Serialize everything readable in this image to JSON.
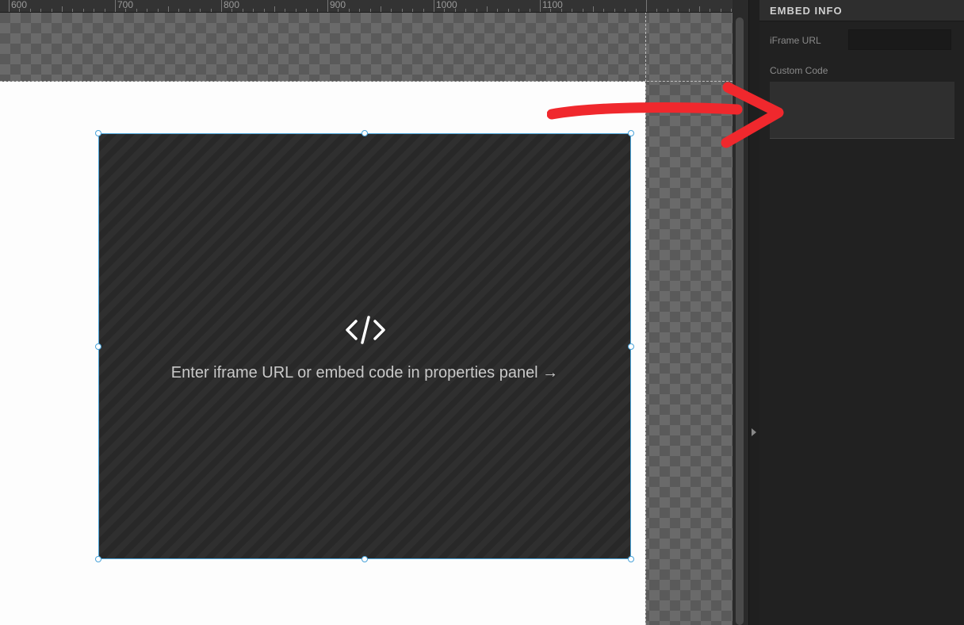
{
  "ruler": {
    "labels": [
      "600",
      "700",
      "800",
      "900",
      "1000",
      "1100"
    ]
  },
  "embed_placeholder": {
    "icon": "code-icon",
    "message": "Enter iframe URL or embed code in properties panel →"
  },
  "panel": {
    "title": "EMBED INFO",
    "iframe_url_label": "iFrame URL",
    "iframe_url_value": "",
    "custom_code_label": "Custom Code",
    "custom_code_value": ""
  },
  "colors": {
    "selection": "#4aa3d9",
    "annotation_arrow": "#f0282d",
    "panel_bg": "#212121"
  }
}
